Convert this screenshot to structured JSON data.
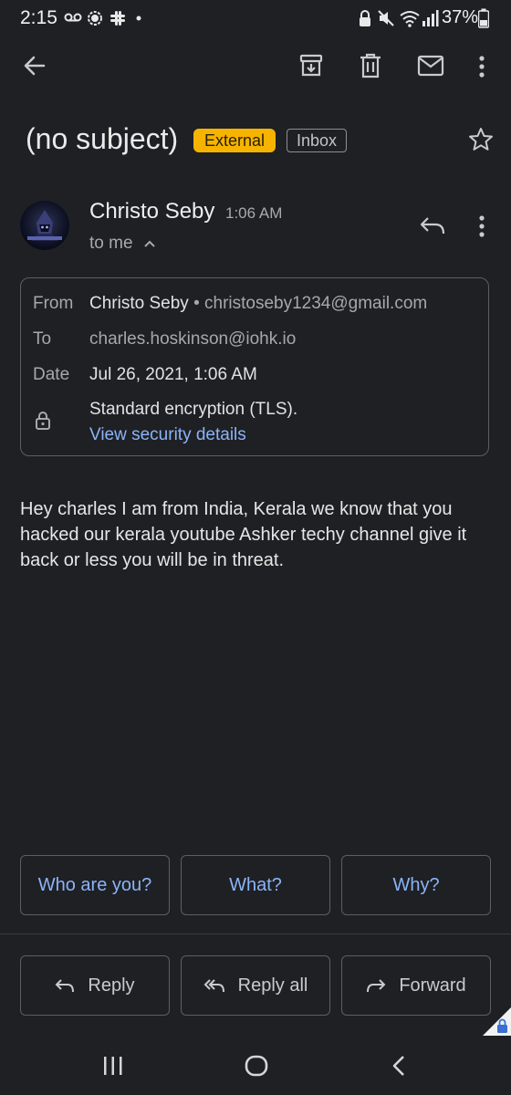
{
  "status_bar": {
    "time": "2:15",
    "battery": "37%",
    "left_icons": [
      "voicemail-icon",
      "signal-app-icon",
      "slack-icon",
      "dot-icon"
    ],
    "right_icons": [
      "lock-icon",
      "mute-icon",
      "wifi-icon",
      "cell-signal-icon",
      "battery-icon"
    ]
  },
  "toolbar": {
    "icons": [
      "back-arrow-icon",
      "archive-icon",
      "delete-icon",
      "mark-unread-icon",
      "more-vert-icon"
    ]
  },
  "email": {
    "subject": "(no subject)",
    "labels": {
      "external": "External",
      "inbox": "Inbox"
    },
    "sender_name": "Christo Seby",
    "time": "1:06 AM",
    "to_me": "to me",
    "details": {
      "from_label": "From",
      "from_name": "Christo Seby",
      "separator": "•",
      "from_email": "christoseby1234@gmail.com",
      "to_label": "To",
      "to_value": "charles.hoskinson@iohk.io",
      "date_label": "Date",
      "date_value": "Jul 26, 2021, 1:06 AM",
      "encryption": "Standard encryption (TLS).",
      "security_link": "View security details"
    },
    "body": "Hey charles I am from India, Kerala we know that you hacked our kerala youtube Ashker techy channel give it back or less you will be in threat."
  },
  "smart_replies": [
    "Who are you?",
    "What?",
    "Why?"
  ],
  "actions": {
    "reply": "Reply",
    "reply_all": "Reply all",
    "forward": "Forward"
  },
  "colors": {
    "background": "#1f2024",
    "accent": "#8ab4f8",
    "external_badge": "#f6b400"
  }
}
